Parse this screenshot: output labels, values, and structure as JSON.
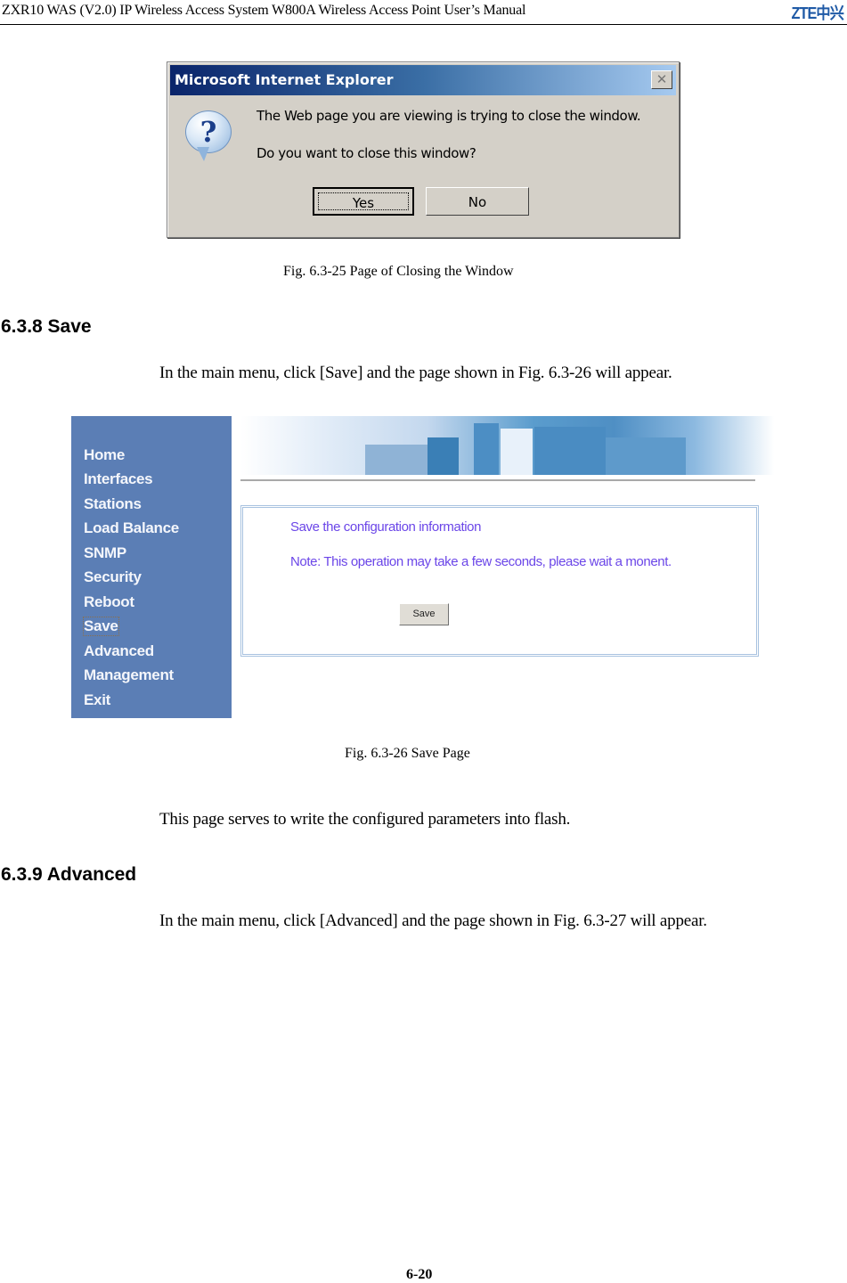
{
  "header": {
    "title": "ZXR10 WAS (V2.0) IP Wireless Access System W800A Wireless Access Point User’s Manual",
    "logo": "ZTE中兴"
  },
  "figure_25": {
    "dialog": {
      "title": "Microsoft Internet Explorer",
      "close_glyph": "✕",
      "icon": "question-icon",
      "icon_glyph": "?",
      "message_line1": "The Web page you are viewing is trying to close the window.",
      "message_line2": "Do you want to close this window?",
      "yes_label": "Yes",
      "no_label": "No"
    },
    "caption": "Fig. 6.3-25  Page of Closing the Window"
  },
  "section_638": {
    "heading": "6.3.8 Save",
    "intro": "In the main menu, click [Save] and the page shown in Fig. 6.3-26 will appear."
  },
  "figure_26": {
    "sidebar": {
      "items": [
        {
          "label": "Home"
        },
        {
          "label": "Interfaces"
        },
        {
          "label": "Stations"
        },
        {
          "label": "Load Balance"
        },
        {
          "label": "SNMP"
        },
        {
          "label": "Security"
        },
        {
          "label": "Reboot"
        },
        {
          "label": "Save",
          "active": true
        },
        {
          "label": "Advanced"
        },
        {
          "label": "Management"
        },
        {
          "label": "Exit"
        }
      ]
    },
    "panel": {
      "title": "Save the configuration information",
      "note": "Note: This operation may take a few seconds, please wait a monent.",
      "save_button": "Save"
    },
    "colors": {
      "sidebar_bg": "#5b7eb5",
      "panel_text": "#6b46e8"
    },
    "caption": "Fig. 6.3-26    Save Page"
  },
  "save_description": "This page serves to write the configured parameters into flash.",
  "section_639": {
    "heading": "6.3.9 Advanced",
    "intro": "In the main menu, click [Advanced] and the page shown in Fig. 6.3-27 will appear."
  },
  "footer": {
    "page_number": "6-20"
  }
}
